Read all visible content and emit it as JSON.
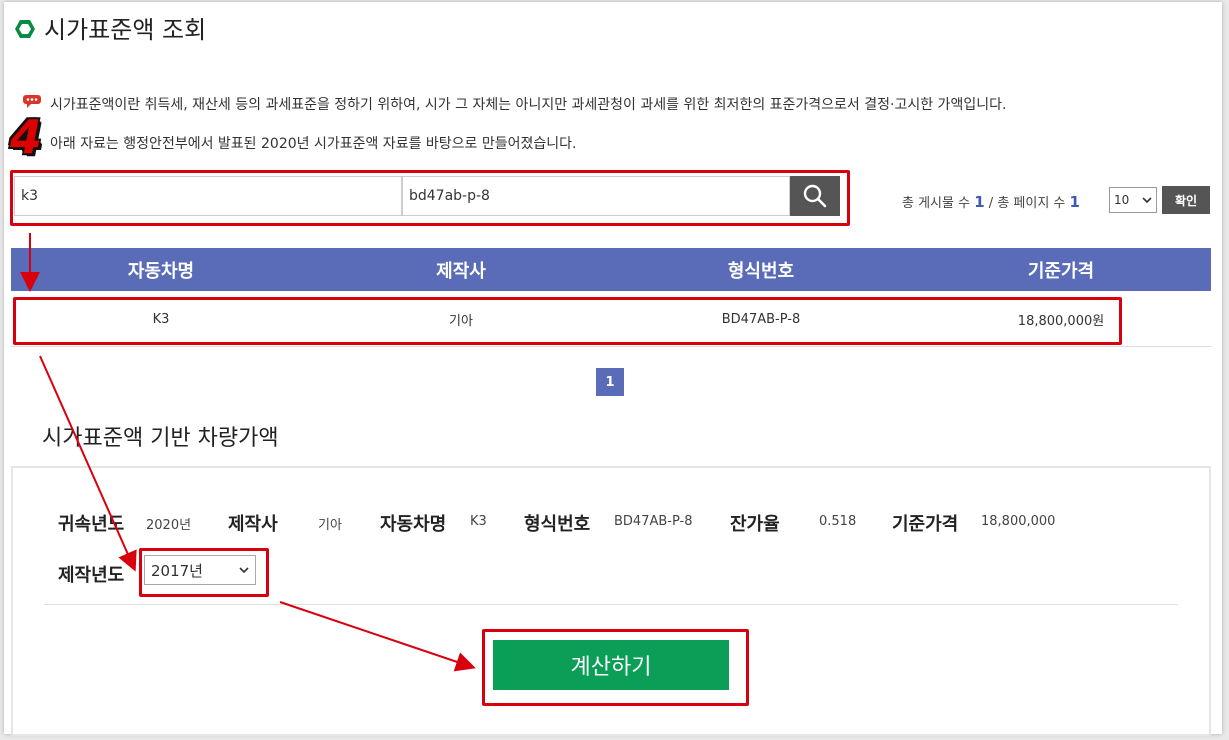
{
  "header": {
    "title": "시가표준액 조회"
  },
  "notices": [
    "시가표준액이란 취득세, 재산세 등의 과세표준을 정하기 위하여, 시가 그 자체는 아니지만 과세관청이 과세를 위한 최저한의 표준가격으로서 결정·고시한 가액입니다.",
    "아래 자료는 행정안전부에서 발표된 2020년 시가표준액 자료를 바탕으로 만들어졌습니다."
  ],
  "step_badge": "4",
  "search": {
    "model_value": "k3",
    "code_value": "bd47ab-p-8"
  },
  "meta": {
    "total_posts_label": "총 게시물 수",
    "total_posts": "1",
    "separator": "/",
    "total_pages_label": "총 페이지 수",
    "total_pages": "1",
    "page_size": "10",
    "confirm_label": "확인"
  },
  "table": {
    "headers": [
      "자동차명",
      "제작사",
      "형식번호",
      "기준가격"
    ],
    "rows": [
      [
        "K3",
        "기아",
        "BD47AB-P-8",
        "18,800,000원"
      ]
    ]
  },
  "pagination": {
    "current": "1"
  },
  "section": {
    "title": "시가표준액 기반 차량가액"
  },
  "info": {
    "year_label": "귀속년도",
    "year_value": "2020년",
    "maker_label": "제작사",
    "maker_value": "기아",
    "car_label": "자동차명",
    "car_value": "K3",
    "code_label": "형식번호",
    "code_value": "BD47AB-P-8",
    "rate_label": "잔가율",
    "rate_value": "0.518",
    "price_label": "기준가격",
    "price_value": "18,800,000",
    "made_year_label": "제작년도",
    "made_year_value": "2017년"
  },
  "calc_button": "계산하기",
  "colors": {
    "header_blue": "#5a6cb8",
    "calc_green": "#0a9e57",
    "annotation_red": "#d9000d"
  }
}
